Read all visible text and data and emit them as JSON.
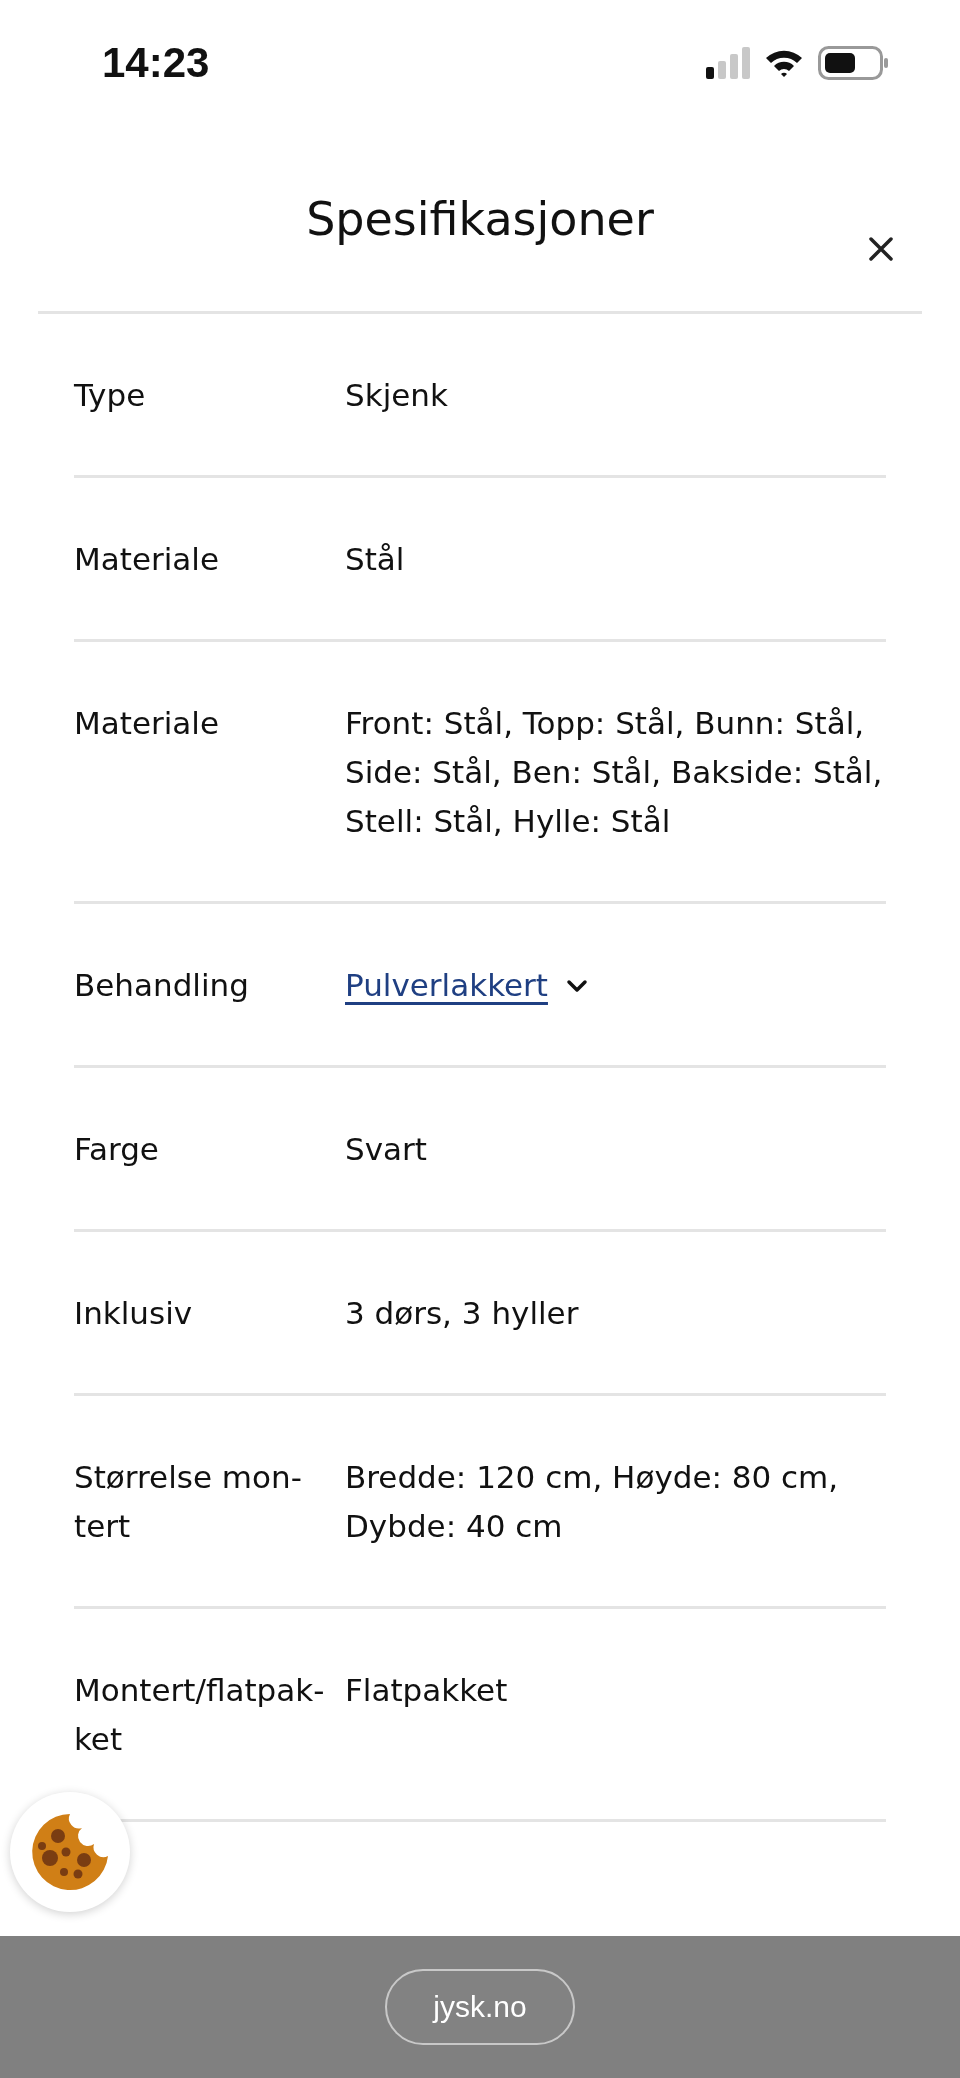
{
  "status_bar": {
    "time": "14:23"
  },
  "header": {
    "title": "Spesifikasjoner"
  },
  "rows": [
    {
      "kind": "text",
      "label": [
        "Type"
      ],
      "value": [
        "Skjenk"
      ]
    },
    {
      "kind": "text",
      "label": [
        "Materiale"
      ],
      "value": [
        "Stål"
      ]
    },
    {
      "kind": "text",
      "label": [
        "Materiale"
      ],
      "value": [
        "Front: Stål, Topp: Stål, Bunn: Stål,",
        "Side: Stål, Ben: Stål, Bakside: Stål,",
        "Stell: Stål, Hylle: Stål"
      ]
    },
    {
      "kind": "link",
      "label": [
        "Behandling"
      ],
      "value": [
        "Pulverlakkert"
      ]
    },
    {
      "kind": "text",
      "label": [
        "Farge"
      ],
      "value": [
        "Svart"
      ]
    },
    {
      "kind": "text",
      "label": [
        "Inklusiv"
      ],
      "value": [
        "3 dørs, 3 hyller"
      ]
    },
    {
      "kind": "text",
      "label": [
        "Størrelse mon-",
        "tert"
      ],
      "value": [
        "Bredde: 120 cm, Høyde: 80 cm,",
        "Dybde: 40 cm"
      ]
    },
    {
      "kind": "text",
      "label": [
        "Montert/flatpak-",
        "ket"
      ],
      "value": [
        "Flatpakket"
      ]
    }
  ],
  "browser_bar": {
    "address": "jysk.no"
  }
}
